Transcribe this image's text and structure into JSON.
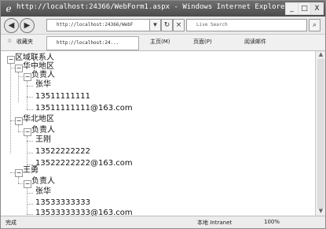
{
  "window": {
    "title": "http://localhost:24366/WebForm1.aspx - Windows Internet Explorer",
    "controls": {
      "minimize": "_",
      "maximize": "□",
      "close": "X"
    }
  },
  "nav": {
    "address": "http://localhost:24366/WebF",
    "search_placeholder": "Live Search"
  },
  "favorites": {
    "favorites_label": "收藏夹",
    "tab_label": "http://localhost:24...",
    "home_label": "主页(M)",
    "page_label": "页面(P)",
    "mail_label": "阅读邮件"
  },
  "tree": {
    "root": "区域联系人",
    "regions": [
      {
        "name": "华中地区",
        "group": "负责人",
        "person": "张华",
        "phone": "13511111111",
        "email": "13511111111@163.com"
      },
      {
        "name": "华北地区",
        "group": "负责人",
        "person": "王刚",
        "phone": "13522222222",
        "email": "13522222222@163.com"
      },
      {
        "name": "王勇",
        "group": "负责人",
        "person": "张华",
        "phone": "13533333333",
        "email": "13533333333@163.com"
      }
    ]
  },
  "status": {
    "done": "完成",
    "zone": "本地 Intranet",
    "zoom": "100%"
  }
}
